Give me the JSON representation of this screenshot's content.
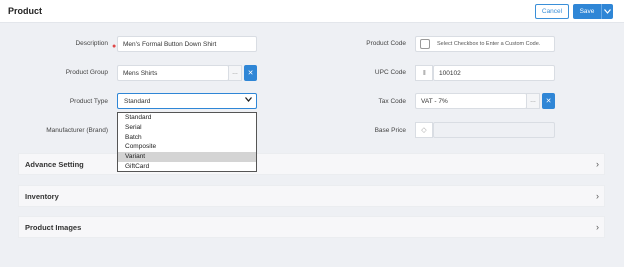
{
  "header": {
    "title": "Product",
    "cancel_label": "Cancel",
    "save_label": "Save"
  },
  "form": {
    "description": {
      "label": "Description",
      "value": "Men's Formal Button Down Shirt"
    },
    "product_group": {
      "label": "Product Group",
      "value": "Mens Shirts"
    },
    "product_type": {
      "label": "Product Type",
      "value": "Standard",
      "options": [
        "Standard",
        "Serial",
        "Batch",
        "Composite",
        "Variant",
        "GiftCard"
      ],
      "highlighted": "Variant"
    },
    "manufacturer": {
      "label": "Manufacturer (Brand)"
    },
    "product_code": {
      "label": "Product Code",
      "checkbox_text": "Select Checkbox to Enter a Custom Code."
    },
    "upc_code": {
      "label": "UPC Code",
      "value": "100102"
    },
    "tax_code": {
      "label": "Tax Code",
      "value": "VAT - 7%"
    },
    "base_price": {
      "label": "Base Price"
    }
  },
  "sections": [
    {
      "label": "Advance Setting"
    },
    {
      "label": "Inventory"
    },
    {
      "label": "Product Images"
    }
  ],
  "icons": {
    "ellipsis": "…",
    "close": "✕",
    "chevron": "›",
    "barcode": "|||",
    "tag": "◇"
  }
}
